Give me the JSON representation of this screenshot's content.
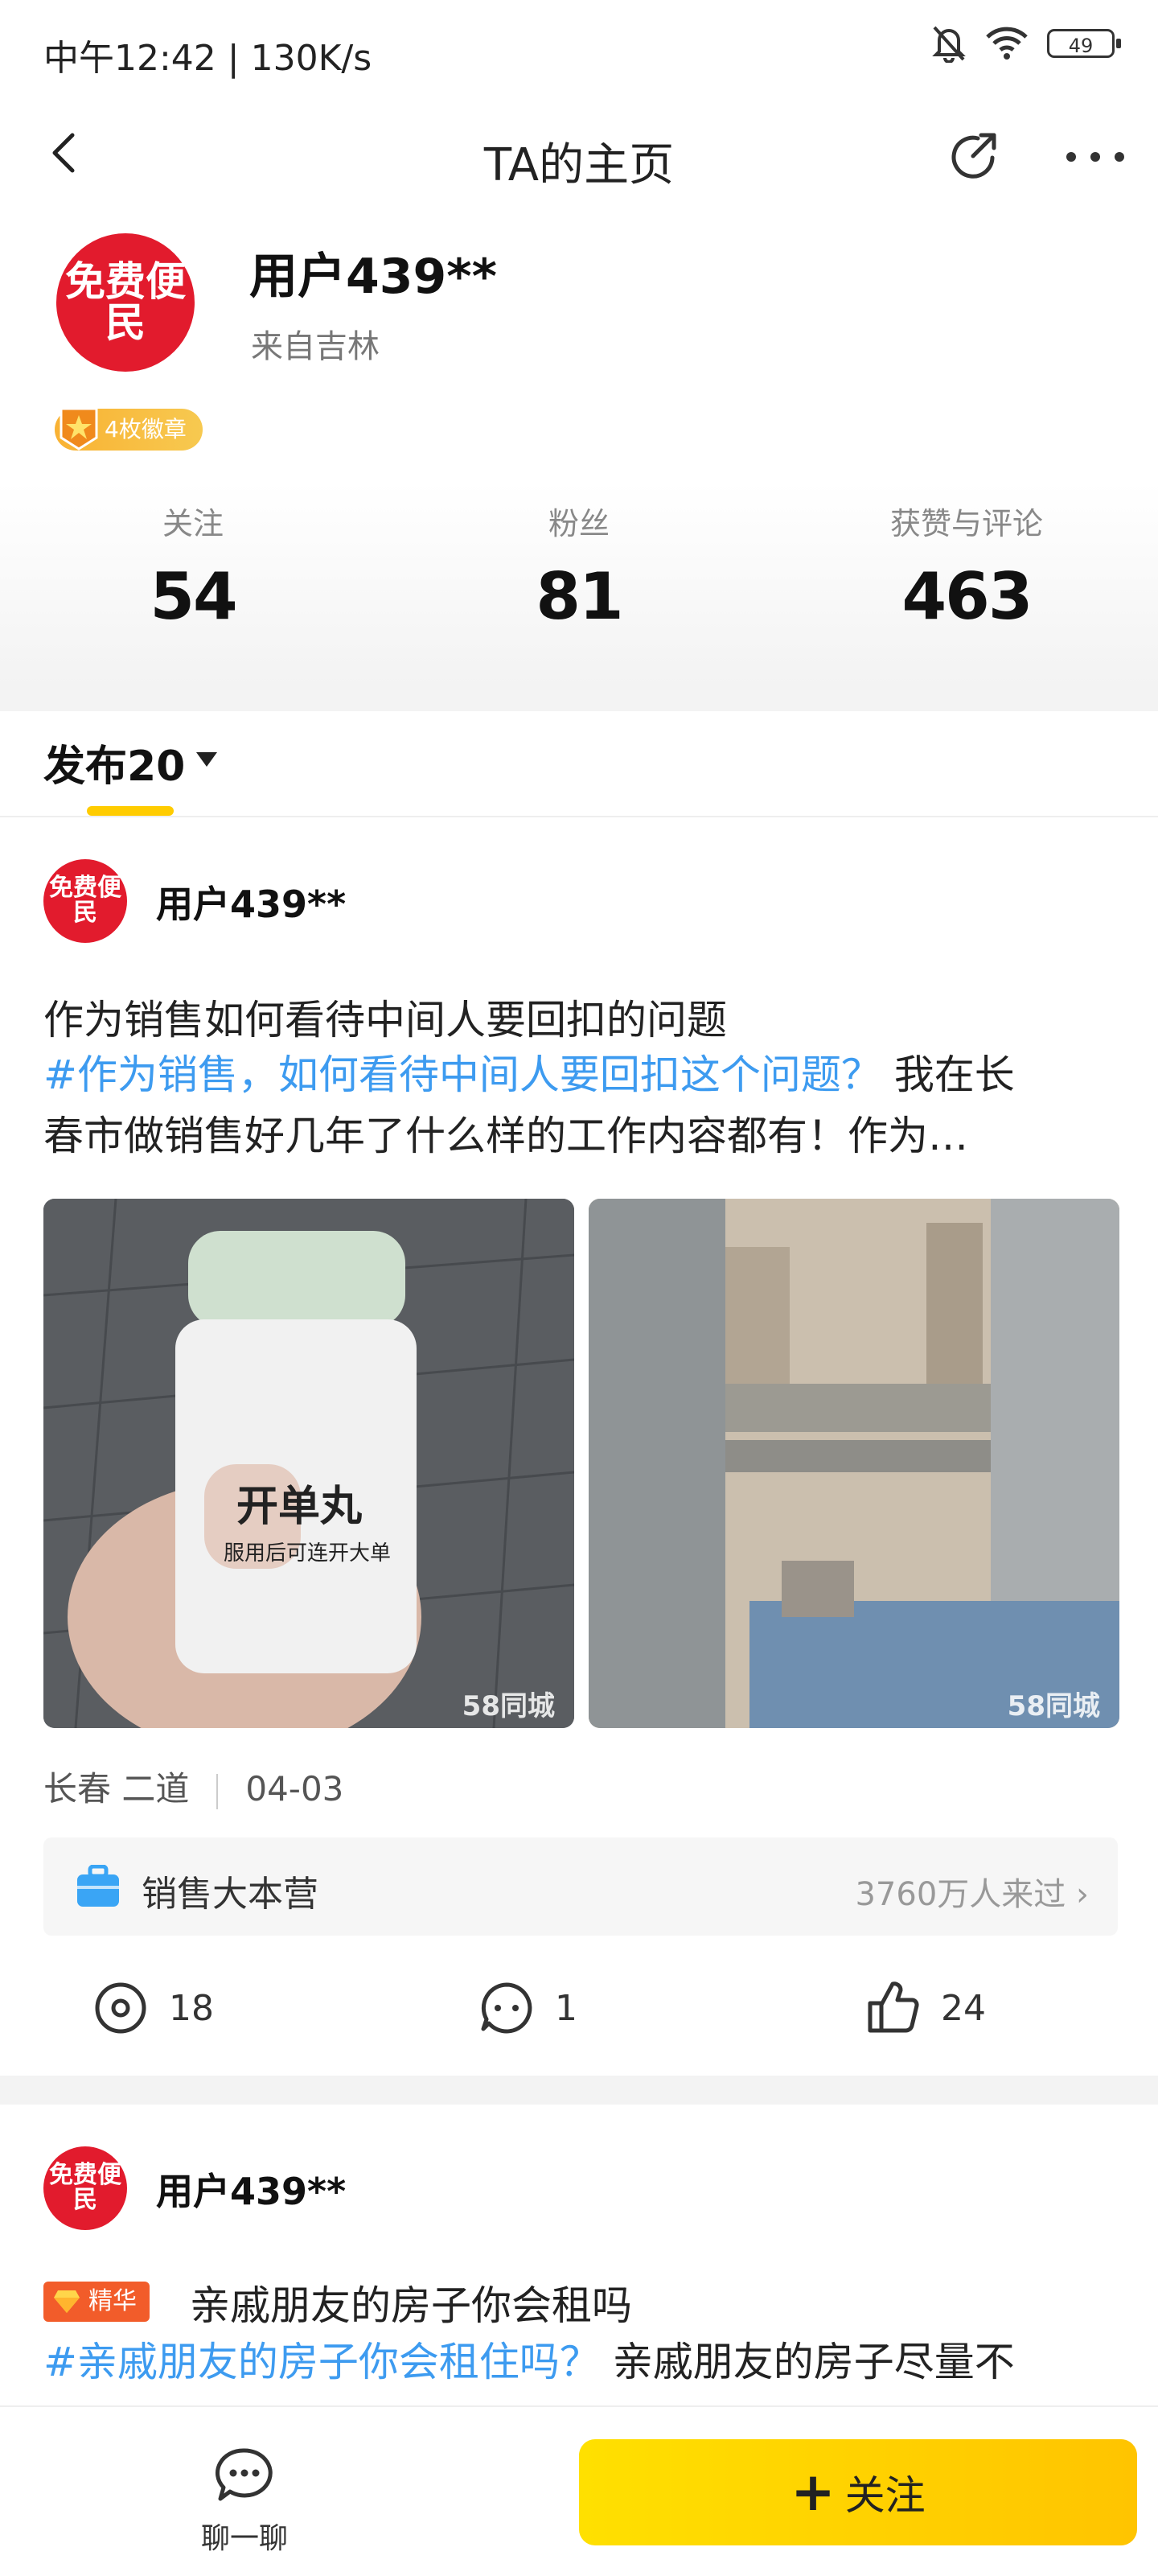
{
  "status_bar": {
    "time": "中午12:42 | 130K/s",
    "battery": "49",
    "icons": [
      "bell-muted-icon",
      "wifi-icon",
      "battery-icon"
    ]
  },
  "header": {
    "title": "TA的主页",
    "icons": [
      "back-arrow-icon",
      "share-icon",
      "more-icon"
    ]
  },
  "profile": {
    "avatar_text": "免费便民",
    "username": "用户439**",
    "location": "来自吉林",
    "badge_label": "4枚徽章"
  },
  "stats": [
    {
      "label": "关注",
      "value": "54"
    },
    {
      "label": "粉丝",
      "value": "81"
    },
    {
      "label": "获赞与评论",
      "value": "463"
    }
  ],
  "tabs": {
    "publish_label": "发布20"
  },
  "posts": [
    {
      "author": "用户439**",
      "avatar_text": "免费便民",
      "title": "作为销售如何看待中间人要回扣的问题",
      "topic": "#作为销售，如何看待中间人要回扣这个问题？",
      "body_line1_rest": "我在长",
      "body_line2": "春市做销售好几年了什么样的工作内容都有！作为…",
      "images": [
        {
          "bottle_title": "开单丸",
          "bottle_subtitle": "服用后可连开大单",
          "watermark": "58同城"
        },
        {
          "watermark": "58同城"
        }
      ],
      "location": "长春 二道",
      "date": "04-03",
      "group": {
        "name": "销售大本营",
        "visits": "3760万人来过 ›"
      },
      "actions": {
        "views": "18",
        "comments": "1",
        "likes": "24"
      }
    },
    {
      "author": "用户439**",
      "avatar_text": "免费便民",
      "essence_tag": "精华",
      "title": "亲戚朋友的房子你会租吗",
      "topic": "#亲戚朋友的房子你会租住吗？",
      "body_line1_rest": "亲戚朋友的房子尽量不"
    }
  ],
  "bottom_bar": {
    "chat_label": "聊一聊",
    "follow_label": "关注"
  },
  "colors": {
    "accent_yellow": "#ffcc00",
    "topic_blue": "#3d9bf0",
    "avatar_red": "#e21b2d",
    "essence_orange": "#f25c2a"
  }
}
